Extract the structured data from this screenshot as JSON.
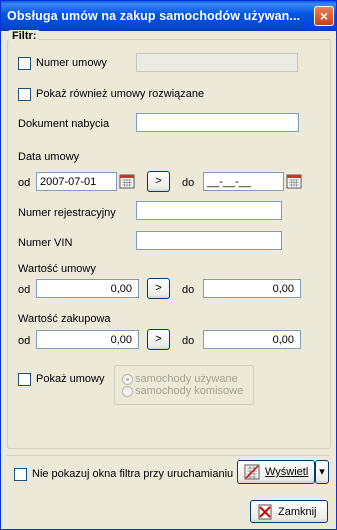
{
  "window": {
    "title": "Obsługa umów na zakup samochodów używan...",
    "close_icon": "×"
  },
  "filter": {
    "legend": "Filtr:",
    "numer_umowy_label": "Numer umowy",
    "numer_umowy_value": "",
    "show_terminated_label": "Pokaż również umowy rozwiązane",
    "dokument_nabycia_label": "Dokument nabycia",
    "dokument_nabycia_value": "",
    "data_umowy_label": "Data umowy",
    "date_from_label": "od",
    "date_from_value": "2007-07-01",
    "date_arrow_label": ">",
    "date_to_label": "do",
    "date_to_value": "__-__-__",
    "numer_rejestracyjny_label": "Numer rejestracyjny",
    "numer_rejestracyjny_value": "",
    "numer_vin_label": "Numer VIN",
    "numer_vin_value": "",
    "wartosc_umowy_label": "Wartość umowy",
    "wartosc_umowy_from_label": "od",
    "wartosc_umowy_from_value": "0,00",
    "wartosc_umowy_arrow": ">",
    "wartosc_umowy_to_label": "do",
    "wartosc_umowy_to_value": "0,00",
    "wartosc_zakupowa_label": "Wartość zakupowa",
    "wartosc_zakupowa_from_label": "od",
    "wartosc_zakupowa_from_value": "0,00",
    "wartosc_zakupowa_arrow": ">",
    "wartosc_zakupowa_to_label": "do",
    "wartosc_zakupowa_to_value": "0,00",
    "pokaz_umowy_label": "Pokaż umowy",
    "radio_used_label": "samochody używane",
    "radio_commission_label": "samochody komisowe"
  },
  "footer": {
    "dont_show_filter_label": "Nie pokazuj okna filtra przy uruchamianiu",
    "show_button_label": "Wyświetl",
    "show_dropdown_icon": "▾",
    "close_button_label": "Zamknij"
  },
  "colors": {
    "title_bar": "#0054e3",
    "window_bg": "#ece9d8",
    "close_button": "#c7401a"
  }
}
